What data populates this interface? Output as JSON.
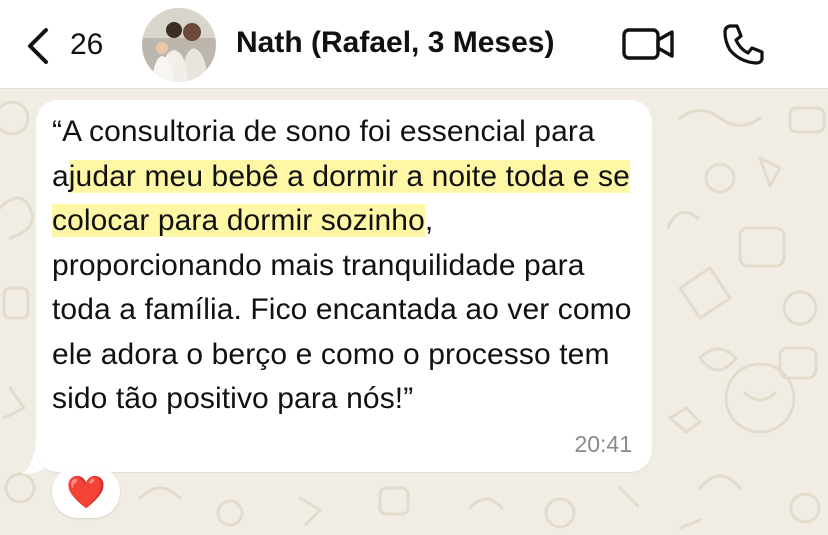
{
  "header": {
    "back_count": "26",
    "contact_name": "Nath (Rafael, 3 Meses)",
    "back_icon": "chevron-left-icon",
    "video_icon": "video-camera-icon",
    "call_icon": "phone-icon"
  },
  "message": {
    "text_before": "“A consultoria de sono foi essencial para a",
    "text_highlight": "judar meu bebê a dormir a noite toda e se colocar para dormir sozinho",
    "text_after": ", proporcionando mais tranquilidade para toda a família. Fico encantada ao ver como ele adora o berço e como o processo tem sido tão positivo para nós!”",
    "time": "20:41",
    "highlight_color": "#fdf7a6"
  },
  "reaction": {
    "emoji": "❤️"
  },
  "colors": {
    "header_bg": "#ffffff",
    "wallpaper_bg": "#f2ede4",
    "bubble_bg": "#ffffff",
    "time_color": "#8a8a8a"
  }
}
